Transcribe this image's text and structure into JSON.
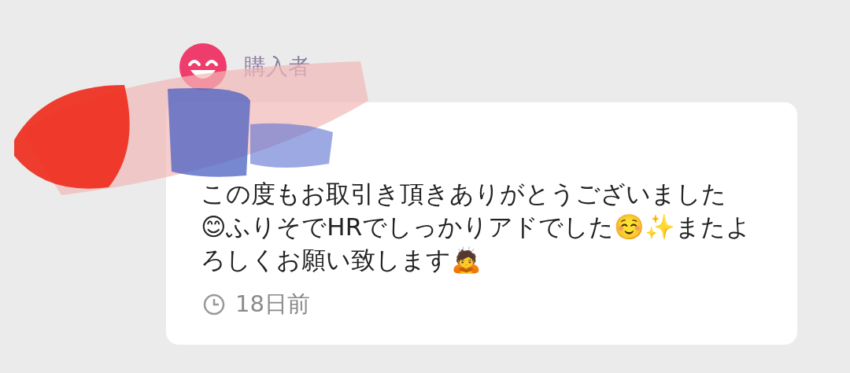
{
  "author": {
    "role": "購入者"
  },
  "message": {
    "text": "この度もお取引き頂きありがとうございました😊ふりそでHRでしっかりアドでした☺️✨またよろしくお願い致します🙇",
    "time": "18日前"
  }
}
